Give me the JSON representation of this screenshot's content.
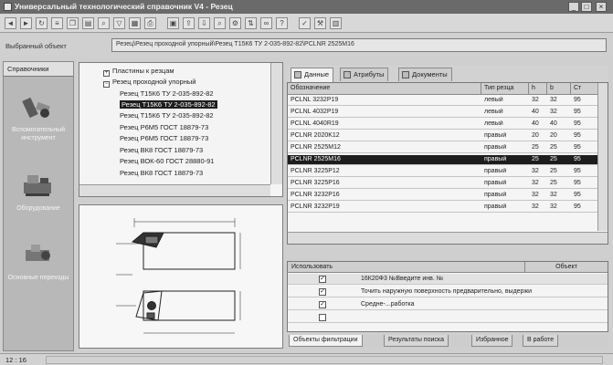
{
  "window": {
    "title": "Универсальный технологический справочник V4 - Резец",
    "buttons": {
      "minimize": "_",
      "maximize": "□",
      "close": "×"
    }
  },
  "toolbar": {
    "icons": [
      "back-icon",
      "forward-icon",
      "refresh-icon",
      "tree-icon",
      "copy-icon",
      "paste-icon",
      "search-icon",
      "filter-icon",
      "grid-icon",
      "print-icon",
      "save-icon",
      "export-icon",
      "import-icon",
      "find-icon",
      "settings-icon",
      "sort-icon",
      "link-icon",
      "help-icon",
      "check-icon",
      "tools-icon",
      "calc-icon"
    ]
  },
  "object_row": {
    "label": "Выбранный объект",
    "value": "Резец\\Резец проходной упорный\\Резец Т15К6 ТУ 2-035-892-82\\PCLNR 2525M16"
  },
  "left_panel": {
    "header": "Справочники",
    "categories": [
      {
        "label": "Вспомогательный инструмент",
        "icon": "tool-holder-icon"
      },
      {
        "label": "Оборудование",
        "icon": "machine-icon"
      },
      {
        "label": "Основные переходы",
        "icon": "transitions-icon"
      }
    ]
  },
  "tree": {
    "items": [
      {
        "label": "Пластины к резцам",
        "expander": "+"
      },
      {
        "label": "Резец проходной упорный",
        "expander": "−"
      },
      {
        "label": "Резец Т15К6 ТУ 2-035-892-82"
      },
      {
        "label": "Резец Т15К6 ТУ 2-035-892-82",
        "selected": true
      },
      {
        "label": "Резец Т15К6 ТУ 2-035-892-82"
      },
      {
        "label": "Резец Р6М5 ГОСТ 18879-73"
      },
      {
        "label": "Резец Р6М5 ГОСТ 18879-73"
      },
      {
        "label": "Резец ВК8 ГОСТ 18879-73"
      },
      {
        "label": "Резец ВОК-60 ГОСТ 28880-91"
      },
      {
        "label": "Резец ВК8 ГОСТ 18879-73"
      }
    ]
  },
  "tabs_top": [
    {
      "label": "Данные",
      "active": true,
      "icon": "data-icon"
    },
    {
      "label": "Атрибуты",
      "active": false,
      "icon": "attributes-icon"
    },
    {
      "label": "Документы",
      "active": false,
      "icon": "documents-icon"
    }
  ],
  "grid": {
    "columns": [
      "Обозначение",
      "Тип резца",
      "h",
      "b",
      "Ст"
    ],
    "rows": [
      [
        "PCLNL 3232P19",
        "левый",
        "32",
        "32",
        "95"
      ],
      [
        "PCLNL 4032P19",
        "левый",
        "40",
        "32",
        "95"
      ],
      [
        "PCLNL 4040R19",
        "левый",
        "40",
        "40",
        "95"
      ],
      [
        "PCLNR 2020K12",
        "правый",
        "20",
        "20",
        "95"
      ],
      [
        "PCLNR 2525M12",
        "правый",
        "25",
        "25",
        "95"
      ],
      [
        "PCLNR 2525M16",
        "правый",
        "25",
        "25",
        "95"
      ],
      [
        "PCLNR 3225P12",
        "правый",
        "32",
        "25",
        "95"
      ],
      [
        "PCLNR 3225P16",
        "правый",
        "32",
        "25",
        "95"
      ],
      [
        "PCLNR 3232P16",
        "правый",
        "32",
        "32",
        "95"
      ],
      [
        "PCLNR 3232P19",
        "правый",
        "32",
        "32",
        "95"
      ]
    ],
    "selected_row": 5
  },
  "filters": {
    "headers": [
      "Использовать",
      "Объект"
    ],
    "rows": [
      {
        "checked": true,
        "text": "16К20Ф3 №Введите инв. №"
      },
      {
        "checked": true,
        "text": "Точить наружную поверхность предварительно, выдержи"
      },
      {
        "checked": true,
        "text": "Средне-...работка"
      },
      {
        "checked": false,
        "text": ""
      }
    ]
  },
  "tabs_bottom": [
    {
      "label": "Объекты фильтрации",
      "active": true
    },
    {
      "label": "Результаты поиска",
      "active": false
    },
    {
      "label": "Избранное",
      "active": false
    },
    {
      "label": "В работе",
      "active": false
    }
  ],
  "status": {
    "text": "12 : 16"
  },
  "colors": {
    "selection": "#1d1d1d",
    "panel_bg": "#b8b8b8",
    "titlebar": "#6a6a6a"
  }
}
